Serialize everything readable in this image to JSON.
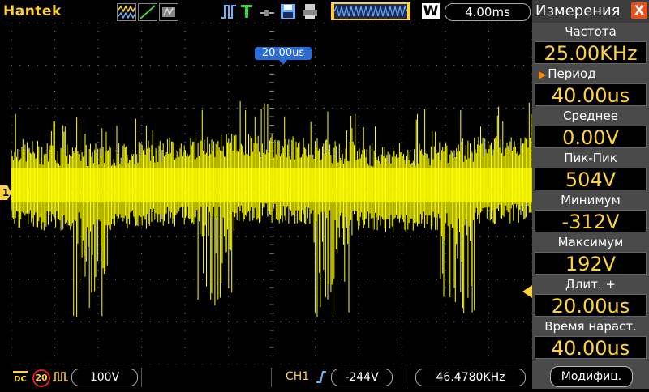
{
  "topbar": {
    "brand": "Hantek",
    "timebase": "4.00ms",
    "mode_letter": "W",
    "icons": [
      "wave-auto-icon",
      "wave-normal-icon",
      "wave-single-icon",
      "pulse-icon",
      "trigger-t-icon",
      "probe-icon",
      "save-icon",
      "print-icon",
      "memory-waveform-icon"
    ]
  },
  "screen": {
    "trigger_position": "20.00us",
    "channel_marker": "1",
    "trace_color": "#ffff00"
  },
  "panel": {
    "title": "Измерения",
    "close_label": "X",
    "measurements": [
      {
        "label": "Частота",
        "value": "25.00KHz",
        "selected": false
      },
      {
        "label": "Период",
        "value": "40.00us",
        "selected": true
      },
      {
        "label": "Среднее",
        "value": "0.00V",
        "selected": false
      },
      {
        "label": "Пик-Пик",
        "value": "504V",
        "selected": false
      },
      {
        "label": "Минимум",
        "value": "-312V",
        "selected": false
      },
      {
        "label": "Максимум",
        "value": "192V",
        "selected": false
      },
      {
        "label": "Длит.  +",
        "value": "20.00us",
        "selected": false
      },
      {
        "label": "Время  нараст.",
        "value": "40.00us",
        "selected": false
      }
    ],
    "modify_label": "Модифиц."
  },
  "bottom": {
    "coupling": "DC",
    "bandwidth_limit": "20",
    "volts_div": "100V",
    "trigger_source": "CH1",
    "trigger_level": "-244V",
    "frequency_counter": "46.4780KHz"
  },
  "colors": {
    "accent_yellow": "#ffd23a",
    "trace": "#ffff00",
    "marker_blue": "#2a6bd6",
    "close_orange": "#e8501a"
  }
}
